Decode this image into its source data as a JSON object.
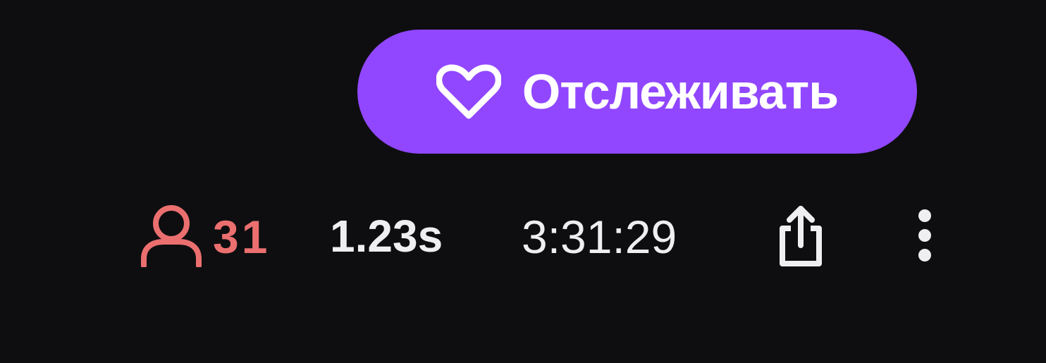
{
  "follow": {
    "label": "Отслеживать",
    "icon": "heart-icon",
    "color": "#9147ff"
  },
  "stats": {
    "viewer_icon": "person-icon",
    "viewer_count": "31",
    "viewer_color": "#eb6f6f",
    "latency": "1.23s",
    "uptime": "3:31:29",
    "share_icon": "share-icon",
    "more_icon": "more-vertical-icon"
  }
}
